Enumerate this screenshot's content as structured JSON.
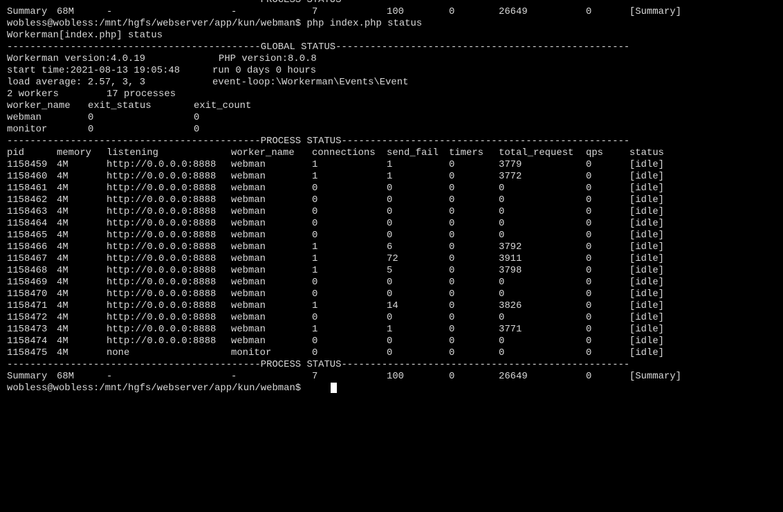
{
  "colors": {
    "background": "#000000",
    "foreground": "#d8d8d8",
    "cursor": "#ffffff"
  },
  "top_separator": "--------------------------------------------PROCESS STATUS--------------------------------------------------",
  "top_summary": [
    "Summary",
    "68M",
    "-",
    "-",
    "7",
    "100",
    "0",
    "26649",
    "0",
    "[Summary]"
  ],
  "command_line": "wobless@wobless:/mnt/hgfs/webserver/app/kun/webman$ php index.php status",
  "app_header": "Workerman[index.php] status",
  "global_separator": "--------------------------------------------GLOBAL STATUS---------------------------------------------------",
  "global": {
    "workerman_version": "Workerman version:4.0.19",
    "php_version": "PHP version:8.0.8",
    "start_time": "start time:2021-08-13 19:05:48",
    "run_time": "run 0 days 0 hours",
    "load_average": "load average: 2.57, 3, 3",
    "event_loop": "event-loop:\\Workerman\\Events\\Event",
    "workers_count": "2 workers",
    "processes_count": "17 processes"
  },
  "worker_table": {
    "headers": [
      "worker_name",
      "exit_status",
      "exit_count"
    ],
    "rows": [
      [
        "webman",
        "0",
        "0"
      ],
      [
        "monitor",
        "0",
        "0"
      ]
    ]
  },
  "process_separator": "--------------------------------------------PROCESS STATUS--------------------------------------------------",
  "process_table": {
    "headers": [
      "pid",
      "memory",
      "listening",
      "worker_name",
      "connections",
      "send_fail",
      "timers",
      "total_request",
      "qps",
      "status"
    ],
    "rows": [
      [
        "1158459",
        "4M",
        "http://0.0.0.0:8888",
        "webman",
        "1",
        "1",
        "0",
        "3779",
        "0",
        "[idle]"
      ],
      [
        "1158460",
        "4M",
        "http://0.0.0.0:8888",
        "webman",
        "1",
        "1",
        "0",
        "3772",
        "0",
        "[idle]"
      ],
      [
        "1158461",
        "4M",
        "http://0.0.0.0:8888",
        "webman",
        "0",
        "0",
        "0",
        "0",
        "0",
        "[idle]"
      ],
      [
        "1158462",
        "4M",
        "http://0.0.0.0:8888",
        "webman",
        "0",
        "0",
        "0",
        "0",
        "0",
        "[idle]"
      ],
      [
        "1158463",
        "4M",
        "http://0.0.0.0:8888",
        "webman",
        "0",
        "0",
        "0",
        "0",
        "0",
        "[idle]"
      ],
      [
        "1158464",
        "4M",
        "http://0.0.0.0:8888",
        "webman",
        "0",
        "0",
        "0",
        "0",
        "0",
        "[idle]"
      ],
      [
        "1158465",
        "4M",
        "http://0.0.0.0:8888",
        "webman",
        "0",
        "0",
        "0",
        "0",
        "0",
        "[idle]"
      ],
      [
        "1158466",
        "4M",
        "http://0.0.0.0:8888",
        "webman",
        "1",
        "6",
        "0",
        "3792",
        "0",
        "[idle]"
      ],
      [
        "1158467",
        "4M",
        "http://0.0.0.0:8888",
        "webman",
        "1",
        "72",
        "0",
        "3911",
        "0",
        "[idle]"
      ],
      [
        "1158468",
        "4M",
        "http://0.0.0.0:8888",
        "webman",
        "1",
        "5",
        "0",
        "3798",
        "0",
        "[idle]"
      ],
      [
        "1158469",
        "4M",
        "http://0.0.0.0:8888",
        "webman",
        "0",
        "0",
        "0",
        "0",
        "0",
        "[idle]"
      ],
      [
        "1158470",
        "4M",
        "http://0.0.0.0:8888",
        "webman",
        "0",
        "0",
        "0",
        "0",
        "0",
        "[idle]"
      ],
      [
        "1158471",
        "4M",
        "http://0.0.0.0:8888",
        "webman",
        "1",
        "14",
        "0",
        "3826",
        "0",
        "[idle]"
      ],
      [
        "1158472",
        "4M",
        "http://0.0.0.0:8888",
        "webman",
        "0",
        "0",
        "0",
        "0",
        "0",
        "[idle]"
      ],
      [
        "1158473",
        "4M",
        "http://0.0.0.0:8888",
        "webman",
        "1",
        "1",
        "0",
        "3771",
        "0",
        "[idle]"
      ],
      [
        "1158474",
        "4M",
        "http://0.0.0.0:8888",
        "webman",
        "0",
        "0",
        "0",
        "0",
        "0",
        "[idle]"
      ],
      [
        "1158475",
        "4M",
        "none",
        "monitor",
        "0",
        "0",
        "0",
        "0",
        "0",
        "[idle]"
      ]
    ]
  },
  "bottom_separator": "--------------------------------------------PROCESS STATUS--------------------------------------------------",
  "bottom_summary": [
    "Summary",
    "68M",
    "-",
    "-",
    "7",
    "100",
    "0",
    "26649",
    "0",
    "[Summary]"
  ],
  "prompt": "wobless@wobless:/mnt/hgfs/webserver/app/kun/webman$ "
}
